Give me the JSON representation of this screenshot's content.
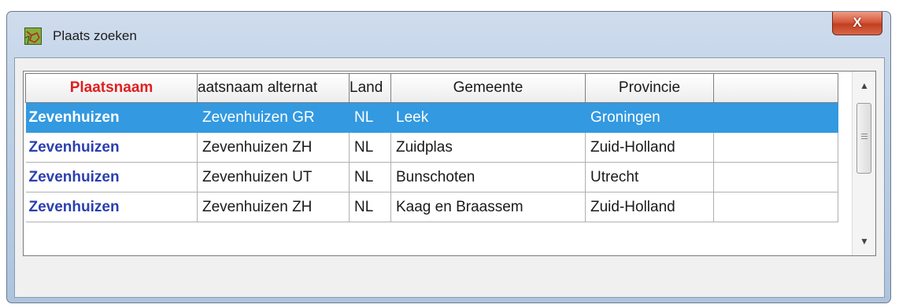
{
  "window": {
    "title": "Plaats zoeken",
    "close_label": "X"
  },
  "grid": {
    "columns": [
      "Plaatsnaam",
      "aatsnaam alternat",
      "Land",
      "Gemeente",
      "Provincie",
      ""
    ],
    "rows": [
      {
        "plaatsnaam": "Zevenhuizen",
        "alternatief": "Zevenhuizen GR",
        "land": "NL",
        "gemeente": "Leek",
        "provincie": "Groningen",
        "selected": true
      },
      {
        "plaatsnaam": "Zevenhuizen",
        "alternatief": "Zevenhuizen ZH",
        "land": "NL",
        "gemeente": "Zuidplas",
        "provincie": "Zuid-Holland",
        "selected": false
      },
      {
        "plaatsnaam": "Zevenhuizen",
        "alternatief": "Zevenhuizen UT",
        "land": "NL",
        "gemeente": "Bunschoten",
        "provincie": "Utrecht",
        "selected": false
      },
      {
        "plaatsnaam": "Zevenhuizen",
        "alternatief": "Zevenhuizen ZH",
        "land": "NL",
        "gemeente": "Kaag en Braassem",
        "provincie": "Zuid-Holland",
        "selected": false
      }
    ]
  },
  "icons": {
    "app": "map-icon",
    "scroll_up": "arrow-up-icon",
    "scroll_down": "arrow-down-icon"
  },
  "colors": {
    "selection": "#3399e0",
    "name_header": "#e02020",
    "name_text": "#2b3fb0"
  }
}
